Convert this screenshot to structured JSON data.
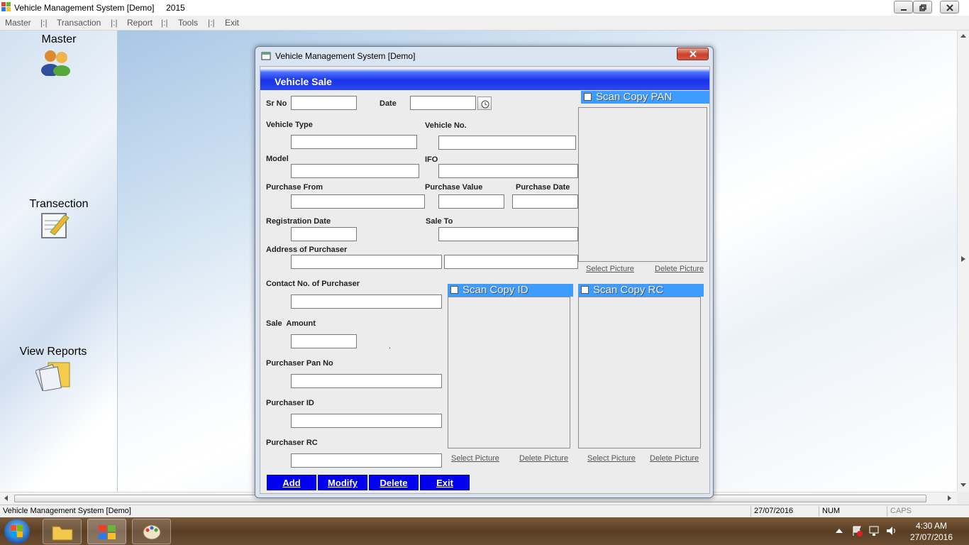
{
  "window": {
    "title": "Vehicle Management System [Demo]     2015"
  },
  "menu": {
    "items": [
      "Master",
      "Transaction",
      "Report",
      "Tools",
      "Exit"
    ],
    "separator": "|:|"
  },
  "sidebar": {
    "items": [
      {
        "label": "Master",
        "icon": "users-icon"
      },
      {
        "label": "Transection",
        "icon": "notepad-pen-icon"
      },
      {
        "label": "View Reports",
        "icon": "reports-folder-icon"
      }
    ]
  },
  "dialog": {
    "title": "Vehicle Management System [Demo]",
    "header": "Vehicle Sale",
    "labels": {
      "sr_no": "Sr No",
      "date": "Date",
      "vehicle_type": "Vehicle Type",
      "vehicle_no": "Vehicle No.",
      "model": "Model",
      "ifo": "IFO",
      "purchase_from": "Purchase From",
      "purchase_value": "Purchase Value",
      "purchase_date": "Purchase Date",
      "registration_date": "Registration Date",
      "sale_to": "Sale To",
      "address": "Address of Purchaser",
      "contact": "Contact No. of Purchaser",
      "sale_amount": "Sale  Amount",
      "pan_no": "Purchaser Pan No",
      "purchaser_id": "Purchaser ID",
      "purchaser_rc": "Purchaser RC"
    },
    "scan": {
      "pan": "Scan Copy PAN",
      "id": "Scan Copy ID",
      "rc": "Scan Copy RC",
      "select": "Select Picture",
      "delete": "Delete Picture"
    },
    "dot": ".",
    "buttons": {
      "add": "Add",
      "modify": "Modify",
      "delete": "Delete",
      "exit": "Exit"
    }
  },
  "status": {
    "app": "Vehicle Management System [Demo]",
    "date": "27/07/2016",
    "num": "NUM",
    "caps": "CAPS"
  },
  "clock": {
    "time": "4:30 AM",
    "date": "27/07/2016"
  },
  "colors": {
    "header_blue": "#1a32e8",
    "scan_head": "#3f9cff",
    "button_blue": "#0000ee"
  }
}
